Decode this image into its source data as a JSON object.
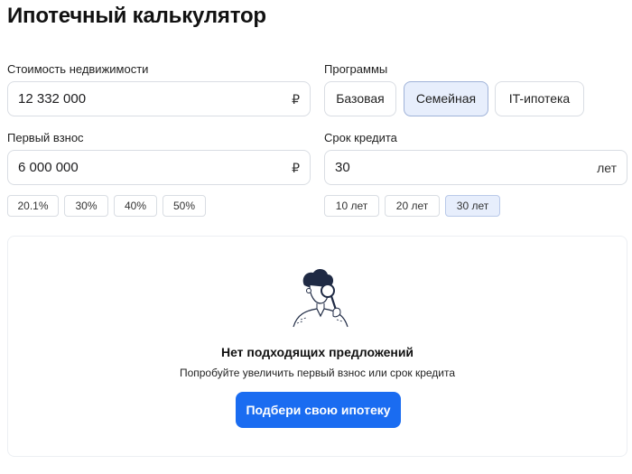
{
  "page": {
    "title": "Ипотечный калькулятор"
  },
  "property_cost": {
    "label": "Стоимость недвижимости",
    "value": "12 332 000",
    "unit": "₽"
  },
  "down_payment": {
    "label": "Первый взнос",
    "value": "6 000 000",
    "unit": "₽",
    "presets": [
      "20.1%",
      "30%",
      "40%",
      "50%"
    ]
  },
  "programs": {
    "label": "Программы",
    "items": [
      "Базовая",
      "Семейная",
      "IT-ипотека"
    ],
    "selected": "Семейная"
  },
  "term": {
    "label": "Срок кредита",
    "value": "30",
    "unit": "лет",
    "presets": [
      "10 лет",
      "20 лет",
      "30 лет"
    ],
    "selected": "30 лет"
  },
  "result": {
    "title": "Нет подходящих предложений",
    "subtitle": "Попробуйте увеличить первый взнос или срок кредита",
    "button": "Подбери свою ипотеку"
  },
  "colors": {
    "accent": "#1a6cf1",
    "selected_bg": "#e7eefc",
    "border": "#d9dde3"
  },
  "icons": {
    "illustration": "person-with-magnifier-illustration"
  }
}
